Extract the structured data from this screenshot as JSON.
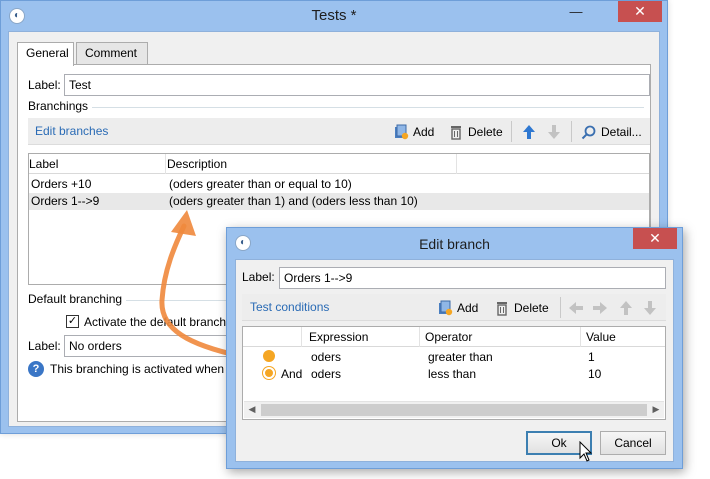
{
  "main_window": {
    "title": "Tests *",
    "close_glyph": "✕",
    "minimize_glyph": "—",
    "tabs": [
      {
        "label": "General"
      },
      {
        "label": "Comment"
      }
    ],
    "label_caption": "Label:",
    "label_value": "Test",
    "branchings_title": "Branchings",
    "toolbar": {
      "edit_link": "Edit branches",
      "add": "Add",
      "delete": "Delete",
      "detail": "Detail..."
    },
    "grid": {
      "columns": [
        "Label",
        "Description"
      ],
      "rows": [
        {
          "label": "Orders +10",
          "description": "(oders greater than or equal to 10)"
        },
        {
          "label": "Orders 1-->9",
          "description": "(oders greater than 1) and (oders less than 10)"
        }
      ]
    },
    "default_branching_title": "Default branching",
    "activate_checkbox_label": "Activate the default branchi",
    "default_label_caption": "Label:",
    "default_label_value": "No orders",
    "help_text": "This branching is activated when t"
  },
  "dialog": {
    "title": "Edit branch",
    "close_glyph": "✕",
    "label_caption": "Label:",
    "label_value": "Orders 1-->9",
    "toolbar": {
      "test_link": "Test conditions",
      "add": "Add",
      "delete": "Delete"
    },
    "grid": {
      "columns": [
        "Expression",
        "Operator",
        "Value"
      ],
      "rows": [
        {
          "connector": "",
          "expression": "oders",
          "operator": "greater than",
          "value": "1"
        },
        {
          "connector": "And",
          "expression": "oders",
          "operator": "less than",
          "value": "10"
        }
      ]
    },
    "ok_button": "Ok",
    "cancel_button": "Cancel"
  },
  "colors": {
    "window_frame": "#9bc1ee",
    "close_button": "#c75050",
    "link": "#2a6bb5",
    "arrow": "#f0883c"
  }
}
